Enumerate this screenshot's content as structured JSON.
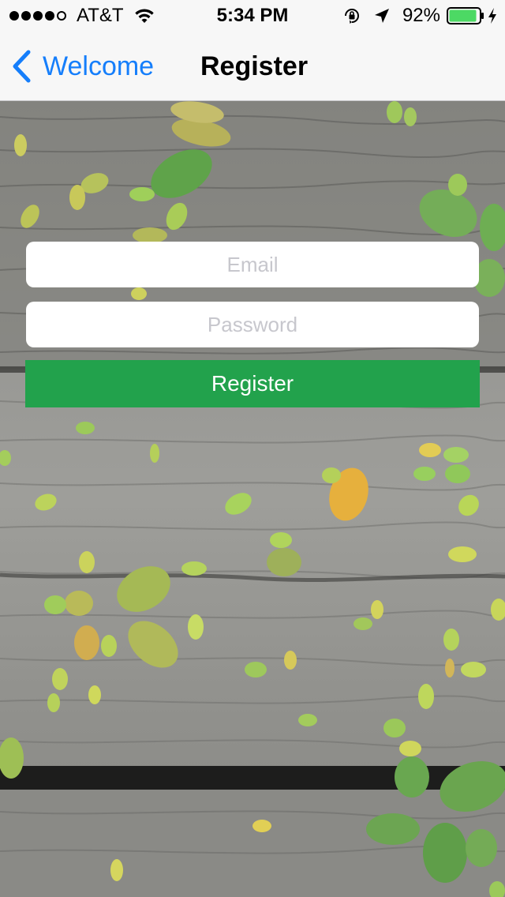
{
  "status_bar": {
    "carrier": "AT&T",
    "time": "5:34 PM",
    "battery_percent": "92%",
    "battery_level": 0.92,
    "signal_bars_filled": 4,
    "signal_bars_total": 5
  },
  "nav_bar": {
    "back_label": "Welcome",
    "title": "Register"
  },
  "form": {
    "email_placeholder": "Email",
    "email_value": "",
    "password_placeholder": "Password",
    "password_value": "",
    "register_label": "Register"
  },
  "colors": {
    "accent_blue": "#157efb",
    "register_green": "#22a24c",
    "battery_green": "#4cd964",
    "placeholder_gray": "#c7c7cd"
  },
  "icons": {
    "wifi": "wifi-icon",
    "orientation_lock": "orientation-lock-icon",
    "location": "location-arrow-icon",
    "battery": "battery-icon",
    "charging": "charging-bolt-icon",
    "back": "chevron-left-icon"
  }
}
